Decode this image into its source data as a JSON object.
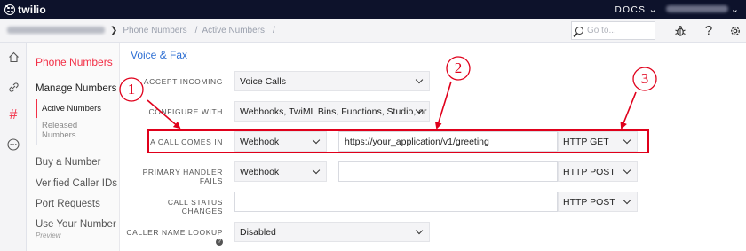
{
  "topbar": {
    "brand": "twilio",
    "docs_label": "DOCS",
    "docs_chevron": "chevron-down-icon",
    "account_chevron": "chevron-down-icon"
  },
  "subheader": {
    "account_chevron": "chevron-down-icon",
    "breadcrumb": [
      "Phone Numbers",
      "Active Numbers"
    ],
    "separator": "/",
    "search_placeholder": "Go to...",
    "debug_icon": "bug-icon",
    "help_icon": "question-icon",
    "settings_icon": "gear-icon"
  },
  "rail": {
    "icons": [
      "home-icon",
      "link-icon",
      "hash-icon",
      "more-icon"
    ],
    "active": "hash-icon"
  },
  "sidenav": {
    "title": "Phone Numbers",
    "group": "Manage Numbers",
    "sub_items": [
      {
        "label": "Active Numbers",
        "active": true
      },
      {
        "label": "Released Numbers",
        "active": false
      }
    ],
    "items": [
      "Buy a Number",
      "Verified Caller IDs",
      "Port Requests",
      "Use Your Number"
    ],
    "preview_tag": "Preview"
  },
  "main": {
    "section_title": "Voice & Fax",
    "fields": {
      "accept_incoming": {
        "label": "ACCEPT INCOMING",
        "value": "Voice Calls"
      },
      "configure_with": {
        "label": "CONFIGURE WITH",
        "value": "Webhooks, TwiML Bins, Functions, Studio, or Proxy"
      },
      "a_call_comes_in": {
        "label": "A CALL COMES IN",
        "type": "Webhook",
        "url": "https://your_application/v1/greeting",
        "method": "HTTP GET"
      },
      "primary_handler_fails": {
        "label": "PRIMARY HANDLER FAILS",
        "type": "Webhook",
        "url": "",
        "method": "HTTP POST"
      },
      "call_status_changes": {
        "label": "CALL STATUS CHANGES",
        "url": "",
        "method": "HTTP POST"
      },
      "caller_name_lookup": {
        "label": "CALLER NAME LOOKUP",
        "value": "Disabled",
        "help": "?"
      }
    }
  },
  "annotations": {
    "numbers": [
      "1",
      "2",
      "3"
    ],
    "color": "#e0001b"
  },
  "colors": {
    "topbar": "#0d122b",
    "brand_red": "#f22f46",
    "link_blue": "#2e6fd3"
  }
}
